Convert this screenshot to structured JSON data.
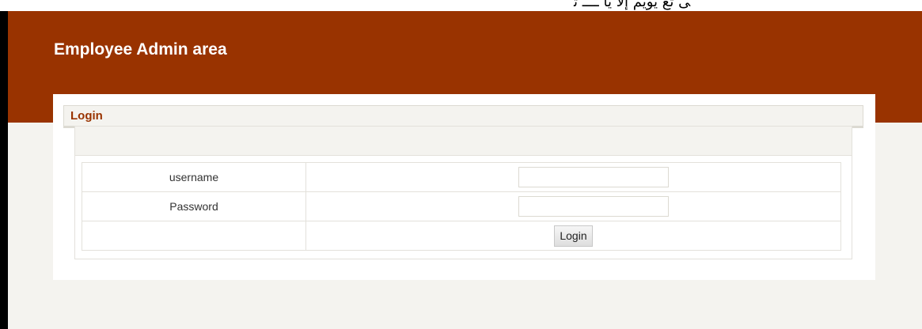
{
  "header": {
    "site_title": "Employee Admin area"
  },
  "login_panel": {
    "title": "Login",
    "fields": {
      "username_label": "username",
      "username_value": "",
      "password_label": "Password",
      "password_value": ""
    },
    "submit_label": "Login"
  },
  "colors": {
    "brand": "#993300",
    "page_background": "#f4f3ef",
    "panel_background": "#ffffff"
  }
}
